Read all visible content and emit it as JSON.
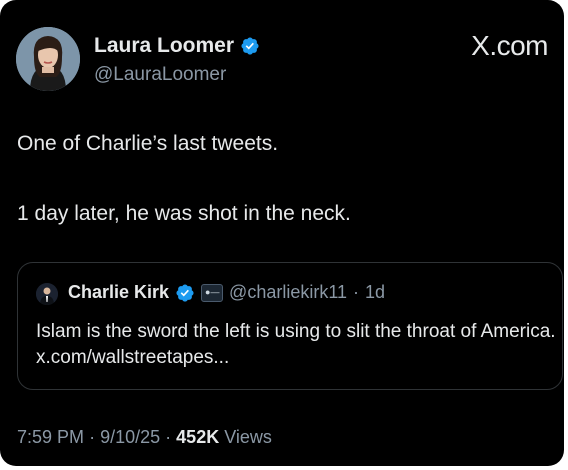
{
  "author": {
    "name": "Laura Loomer",
    "handle": "@LauraLoomer",
    "verified": true,
    "avatar_icon": "author-avatar"
  },
  "brand": {
    "label": "X.com"
  },
  "tweet": {
    "line1": "One of Charlie’s last tweets.",
    "line2": "1 day later, he was shot in the neck."
  },
  "quoted_tweet": {
    "author_name": "Charlie Kirk",
    "verified": true,
    "affiliate_badge_icon": "affiliate-badge-icon",
    "handle": "@charliekirk11",
    "separator": "·",
    "age": "1d",
    "text": "Islam is the sword the left is using to slit the throat of America. x.com/wallstreetapes..."
  },
  "meta": {
    "time": "7:59 PM",
    "sep1": "·",
    "date": "9/10/25",
    "sep2": "·",
    "views_count": "452K",
    "views_label": "Views"
  },
  "colors": {
    "background": "#000000",
    "primary_text": "#e7e9ea",
    "secondary_text": "#8b98a5",
    "verified_blue": "#1d9bf0",
    "border": "#2f3336"
  }
}
